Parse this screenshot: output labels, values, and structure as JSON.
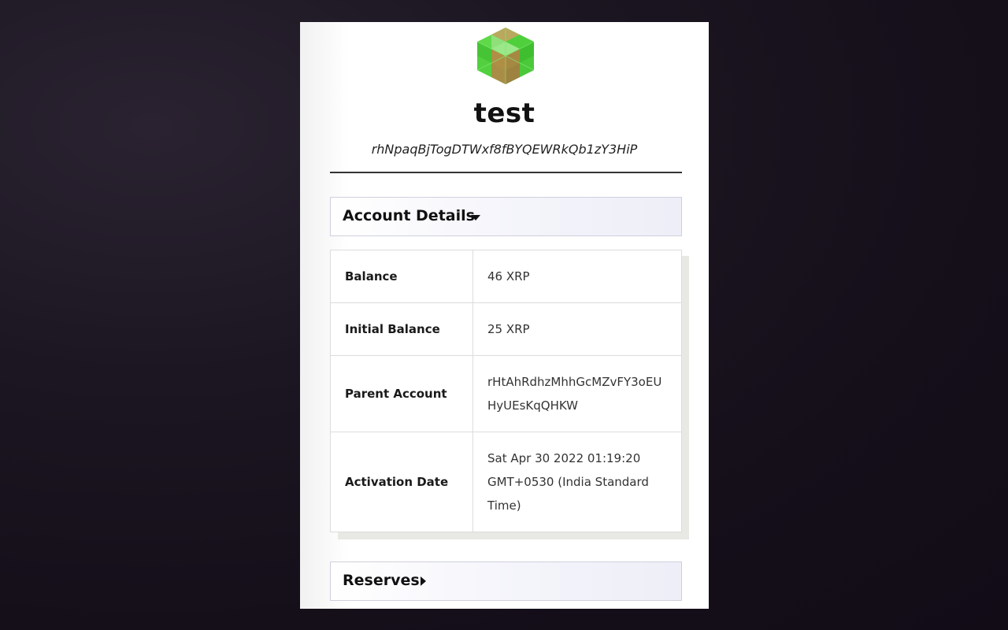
{
  "account": {
    "name": "test",
    "address": "rhNpaqBjTogDTWxf8fBYQEWRkQb1zY3HiP"
  },
  "sections": {
    "account_details": {
      "label": "Account Details",
      "icon": "caret-down-icon",
      "rows": [
        {
          "key": "Balance",
          "value": "46 XRP"
        },
        {
          "key": "Initial Balance",
          "value": "25 XRP"
        },
        {
          "key": "Parent Account",
          "value": "rHtAhRdhzMhhGcMZvFY3oEUHyUEsKqQHKW"
        },
        {
          "key": "Activation Date",
          "value": "Sat Apr 30 2022 01:19:20 GMT+0530 (India Standard Time)"
        }
      ]
    },
    "reserves": {
      "label": "Reserves",
      "icon": "caret-right-icon"
    }
  },
  "colors": {
    "avatar_green": "#5fd94a",
    "avatar_olive": "#b59a4a",
    "background": "#150f1a",
    "panel": "#ffffff"
  }
}
